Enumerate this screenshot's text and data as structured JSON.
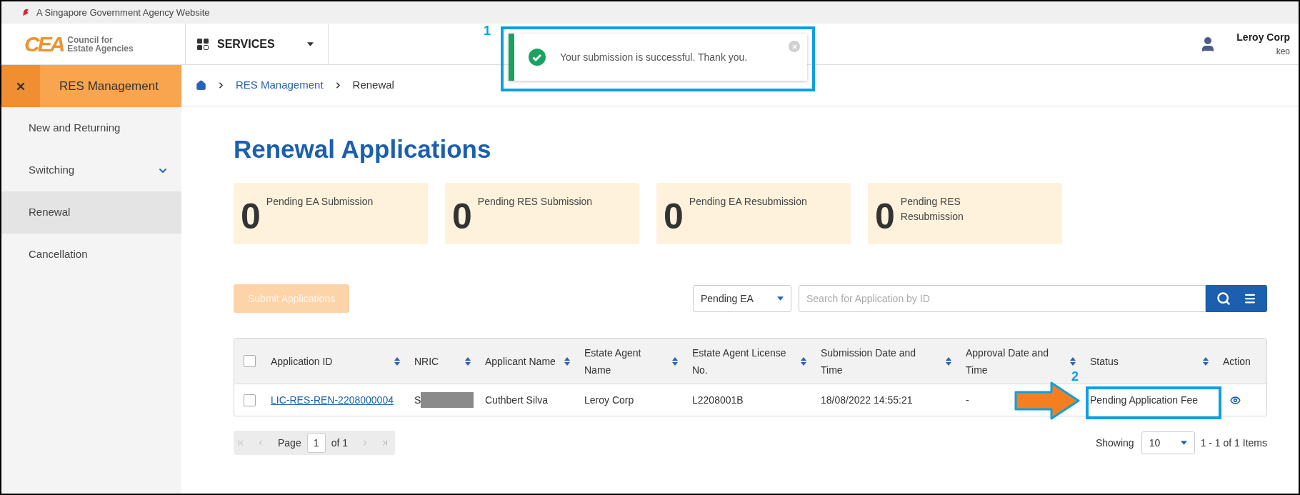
{
  "gov_banner": {
    "text": "A Singapore Government Agency Website"
  },
  "header": {
    "logo": {
      "mark": "CEA",
      "line1": "Council for",
      "line2": "Estate Agencies"
    },
    "services": {
      "label": "SERVICES"
    },
    "user": {
      "name": "Leroy Corp",
      "username": "keo"
    }
  },
  "toast": {
    "message": "Your submission is successful. Thank you."
  },
  "sidebar": {
    "heading": "RES Management",
    "items": [
      {
        "label": "New and Returning",
        "selected": false,
        "expandable": false
      },
      {
        "label": "Switching",
        "selected": false,
        "expandable": true
      },
      {
        "label": "Renewal",
        "selected": true,
        "expandable": false
      },
      {
        "label": "Cancellation",
        "selected": false,
        "expandable": false
      }
    ]
  },
  "breadcrumb": [
    {
      "label": "RES Management",
      "kind": "link"
    },
    {
      "label": "Renewal",
      "kind": "current"
    }
  ],
  "title": "Renewal Applications",
  "summary_cards": [
    {
      "count": "0",
      "label": "Pending EA Submission"
    },
    {
      "count": "0",
      "label": "Pending RES Submission"
    },
    {
      "count": "0",
      "label": "Pending EA Resubmission"
    },
    {
      "count": "0",
      "label": "Pending RES Resubmission"
    }
  ],
  "submit_button": {
    "label": "Submit Applications",
    "disabled": true
  },
  "filter": {
    "value": "Pending EA"
  },
  "search": {
    "placeholder": "Search for Application by ID"
  },
  "table": {
    "all_selected": false,
    "columns": [
      {
        "label": "Application ID",
        "sortable": true
      },
      {
        "label": "NRIC",
        "sortable": true
      },
      {
        "label": "Applicant Name",
        "sortable": true
      },
      {
        "label": "Estate Agent Name",
        "sortable": true
      },
      {
        "label": "Estate Agent License No.",
        "sortable": true
      },
      {
        "label": "Submission Date and Time",
        "sortable": true
      },
      {
        "label": "Approval Date and Time",
        "sortable": true
      },
      {
        "label": "Status",
        "sortable": true
      },
      {
        "label": "Action",
        "sortable": false
      }
    ],
    "rows": [
      {
        "selected": false,
        "application_id": "LIC-RES-REN-2208000004",
        "nric": "S",
        "applicant_name": "Cuthbert Silva",
        "agent_name": "Leroy Corp",
        "license_no": "L2208001B",
        "submission": "18/08/2022 14:55:21",
        "approval": "-",
        "status": "Pending Application Fee"
      }
    ]
  },
  "pagination": {
    "page_label": "Page",
    "page": "1",
    "of_label": "of 1",
    "showing_label": "Showing",
    "page_size": "10",
    "range": "1 - 1 of 1 Items"
  },
  "annotations": [
    {
      "label": "1"
    },
    {
      "label": "2"
    }
  ]
}
